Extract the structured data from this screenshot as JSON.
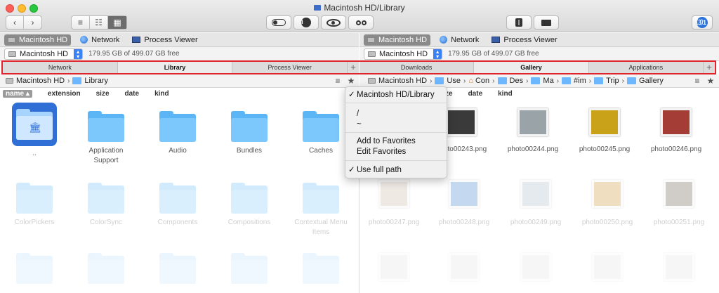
{
  "window": {
    "title": "Macintosh HD/Library"
  },
  "toolbar": {
    "back_icon": "chevron-left-icon",
    "forward_icon": "chevron-right-icon",
    "view_modes": [
      "list-icon",
      "columns-icon",
      "grid-icon"
    ],
    "right_buttons": [
      "toggle-icon",
      "info-icon",
      "eye-icon",
      "binoculars-icon"
    ],
    "split_icon": "split-panel-icon",
    "screen_icon": "screen-icon",
    "badge": "⑶1"
  },
  "left": {
    "devices": [
      "Macintosh HD",
      "Network",
      "Process Viewer"
    ],
    "volume": "Macintosh HD",
    "free_text": "179.95 GB of 499.07 GB free",
    "tabs": [
      "Network",
      "Library",
      "Process Viewer"
    ],
    "active_tab": "Library",
    "path": [
      "Macintosh HD",
      "Library"
    ],
    "sort_columns": [
      "name ▴",
      "extension",
      "size",
      "date",
      "kind"
    ],
    "items": [
      {
        "label": "..",
        "selected": true
      },
      {
        "label": "Application\nSupport"
      },
      {
        "label": "Audio"
      },
      {
        "label": "Bundles"
      },
      {
        "label": "Caches"
      },
      {
        "label": "ColorPickers"
      },
      {
        "label": "ColorSync"
      },
      {
        "label": "Components"
      },
      {
        "label": "Compositions"
      },
      {
        "label": "Contextual Menu\nItems"
      }
    ]
  },
  "right": {
    "devices": [
      "Macintosh HD",
      "Network",
      "Process Viewer"
    ],
    "volume": "Macintosh HD",
    "free_text": "179.95 GB of 499.07 GB free",
    "tabs": [
      "Downloads",
      "Gallery",
      "Applications"
    ],
    "active_tab": "Gallery",
    "path": [
      "Macintosh HD",
      "Use",
      "Con",
      "Des",
      "Ma",
      "#im",
      "Trip",
      "Gallery"
    ],
    "sort_columns": [
      "ze",
      "date",
      "kind"
    ],
    "photos": [
      {
        "label": "photo00243.png",
        "color": "#3a3a3a"
      },
      {
        "label": "photo00244.png",
        "color": "#9aa3a8"
      },
      {
        "label": "photo00245.png",
        "color": "#c9a21a"
      },
      {
        "label": "photo00246.png",
        "color": "#a33d35"
      },
      {
        "label": "photo00247.png",
        "color": "#c8b4a0"
      },
      {
        "label": "photo00248.png",
        "color": "#2f79c8"
      },
      {
        "label": "photo00249.png",
        "color": "#a6b6c6"
      },
      {
        "label": "photo00250.png",
        "color": "#c8901f"
      },
      {
        "label": "photo00251.png",
        "color": "#5a4a3e"
      }
    ]
  },
  "menu": {
    "items": [
      {
        "label": "Macintosh HD/Library",
        "checked": true
      },
      {
        "label": "/"
      },
      {
        "label": "~"
      },
      {
        "label": "Add to Favorites"
      },
      {
        "label": "Edit Favorites"
      },
      {
        "label": "Use full path",
        "checked": true
      }
    ],
    "check_glyph": "✓"
  }
}
